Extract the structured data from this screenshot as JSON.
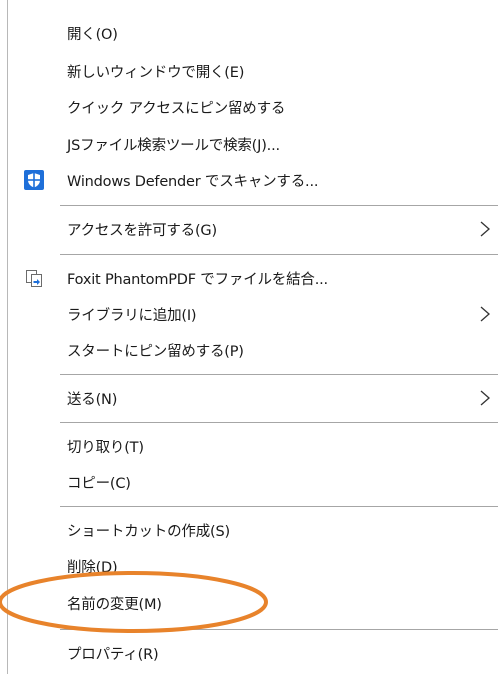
{
  "menu": {
    "items": [
      {
        "label": "開く(O)"
      },
      {
        "label": "新しいウィンドウで開く(E)"
      },
      {
        "label": "クイック アクセスにピン留めする"
      },
      {
        "label": "JSファイル検索ツールで検索(J)..."
      },
      {
        "label": "Windows Defender でスキャンする...",
        "icon": "windows-defender-shield-icon"
      },
      {
        "label": "アクセスを許可する(G)",
        "submenu": true
      },
      {
        "label": "Foxit PhantomPDF でファイルを結合...",
        "icon": "foxit-combine-icon"
      },
      {
        "label": "ライブラリに追加(I)",
        "submenu": true
      },
      {
        "label": "スタートにピン留めする(P)"
      },
      {
        "label": "送る(N)",
        "submenu": true
      },
      {
        "label": "切り取り(T)"
      },
      {
        "label": "コピー(C)"
      },
      {
        "label": "ショートカットの作成(S)"
      },
      {
        "label": "削除(D)"
      },
      {
        "label": "名前の変更(M)"
      },
      {
        "label": "プロパティ(R)"
      }
    ]
  },
  "annotation": {
    "highlight_color": "#E8832B",
    "highlighted_item": "名前の変更(M)"
  },
  "colors": {
    "defender_blue": "#1E6FD9",
    "separator": "#A6A6A6",
    "text": "#1A1A1A"
  }
}
